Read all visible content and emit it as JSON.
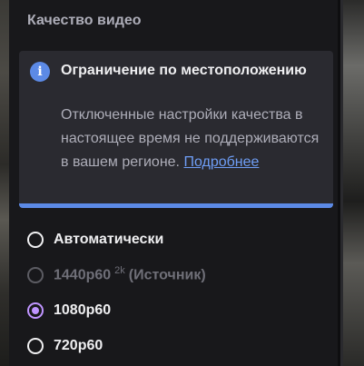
{
  "menu": {
    "title": "Качество видео"
  },
  "notice": {
    "icon": "info-icon",
    "title": "Ограничение по местоположению",
    "body": "Отключенные настройки качества в настоящее время не поддерживаются в вашем регионе.",
    "link": "Подробнее",
    "accent_color": "#5c8ae6"
  },
  "options": [
    {
      "label": "Автоматически",
      "state": "unchecked"
    },
    {
      "label": "1440p60",
      "sup": "2k",
      "extra": "(Источник)",
      "state": "disabled"
    },
    {
      "label": "1080p60",
      "state": "checked"
    },
    {
      "label": "720p60",
      "state": "unchecked"
    }
  ],
  "colors": {
    "selected": "#bf94ff",
    "panel": "#18181b"
  }
}
